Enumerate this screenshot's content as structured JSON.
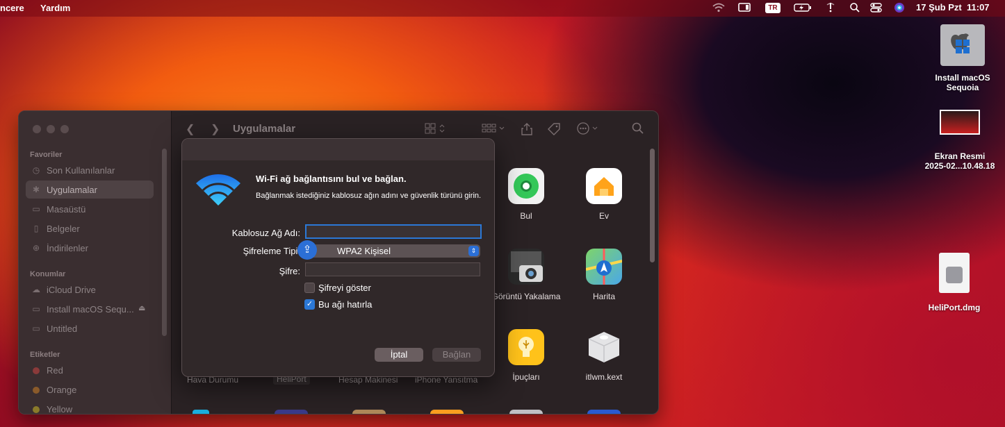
{
  "menubar": {
    "left_items": [
      "ncere",
      "Yardım"
    ],
    "input_source": "TR",
    "date": "17 Şub Pzt",
    "time": "11:07",
    "icons": [
      "wifi-icon",
      "display-icon",
      "battery-icon",
      "alert-icon",
      "search-icon",
      "control-center-icon",
      "siri-icon"
    ]
  },
  "desktop": {
    "items": [
      {
        "label_line1": "Install macOS",
        "label_line2": "Sequoia"
      },
      {
        "label_line1": "Ekran Resmi",
        "label_line2": "2025-02...10.48.18"
      },
      {
        "label_line1": "HeliPort.dmg",
        "label_line2": ""
      }
    ]
  },
  "finder": {
    "title": "Uygulamalar",
    "sidebar": {
      "favorites_header": "Favoriler",
      "favorites": [
        {
          "label": "Son Kullanılanlar",
          "icon": "clock-icon"
        },
        {
          "label": "Uygulamalar",
          "icon": "apps-icon",
          "selected": true
        },
        {
          "label": "Masaüstü",
          "icon": "desktop-icon"
        },
        {
          "label": "Belgeler",
          "icon": "document-icon"
        },
        {
          "label": "İndirilenler",
          "icon": "download-icon"
        }
      ],
      "locations_header": "Konumlar",
      "locations": [
        {
          "label": "iCloud Drive",
          "icon": "cloud-icon"
        },
        {
          "label": "Install macOS Sequ...",
          "icon": "disk-icon"
        },
        {
          "label": "Untitled",
          "icon": "disk-icon"
        }
      ],
      "tags_header": "Etiketler",
      "tags": [
        {
          "label": "Red",
          "color": "#c0392b"
        },
        {
          "label": "Orange",
          "color": "#d68a2a"
        },
        {
          "label": "Yellow",
          "color": "#c9a227"
        }
      ]
    },
    "apps_row1": [
      {
        "label": "Bul"
      },
      {
        "label": "Ev"
      }
    ],
    "apps_row2": [
      {
        "label": "Görüntü Yakalama"
      },
      {
        "label": "Harita"
      }
    ],
    "apps_row3": [
      {
        "label": "Hava Durumu"
      },
      {
        "label": "HeliPort"
      },
      {
        "label": "Hesap Makinesi"
      },
      {
        "label": "iPhone Yansıtma"
      },
      {
        "label": "İpuçları"
      },
      {
        "label": "itlwm.kext"
      }
    ]
  },
  "dialog": {
    "title": "Wi-Fi ağ bağlantısını bul ve bağlan.",
    "subtitle": "Bağlanmak istediğiniz kablosuz ağın adını ve güvenlik türünü girin.",
    "network_label": "Kablosuz Ağ Adı:",
    "network_value": "",
    "security_label": "Şifreleme Tipi:",
    "security_value": "WPA2 Kişisel",
    "password_label": "Şifre:",
    "password_value": "",
    "show_password_label": "Şifreyi göster",
    "show_password_checked": false,
    "remember_label": "Bu ağı hatırla",
    "remember_checked": true,
    "cancel_label": "İptal",
    "connect_label": "Bağlan"
  }
}
